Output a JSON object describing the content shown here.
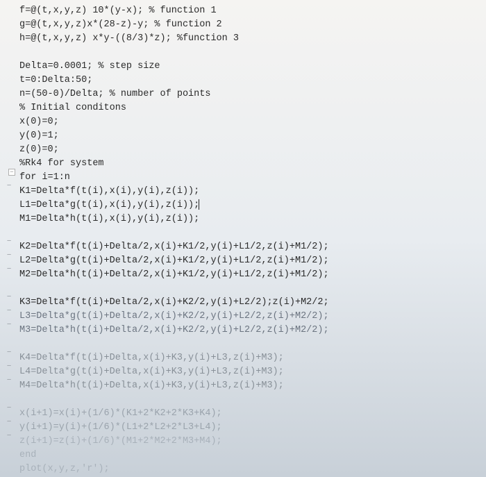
{
  "code": {
    "l1": "f=@(t,x,y,z) 10*(y-x); % function 1",
    "l2": "g=@(t,x,y,z)x*(28-z)-y; % function 2",
    "l3": "h=@(t,x,y,z) x*y-((8/3)*z); %function 3",
    "l4": "",
    "l5": "Delta=0.0001; % step size",
    "l6": "t=0:Delta:50;",
    "l7": "n=(50-0)/Delta; % number of points",
    "l8": "% Initial conditons",
    "l9": "x(0)=0;",
    "l10": "y(0)=1;",
    "l11": "z(0)=0;",
    "l12": "%Rk4 for system",
    "l13": "for i=1:n",
    "l14": "K1=Delta*f(t(i),x(i),y(i),z(i));",
    "l15": "L1=Delta*g(t(i),x(i),y(i),z(i));",
    "l16": "M1=Delta*h(t(i),x(i),y(i),z(i));",
    "l17": "",
    "l18": "K2=Delta*f(t(i)+Delta/2,x(i)+K1/2,y(i)+L1/2,z(i)+M1/2);",
    "l19": "L2=Delta*g(t(i)+Delta/2,x(i)+K1/2,y(i)+L1/2,z(i)+M1/2);",
    "l20": "M2=Delta*h(t(i)+Delta/2,x(i)+K1/2,y(i)+L1/2,z(i)+M1/2);",
    "l21": "",
    "l22": "K3=Delta*f(t(i)+Delta/2,x(i)+K2/2,y(i)+L2/2);z(i)+M2/2;",
    "l23": "L3=Delta*g(t(i)+Delta/2,x(i)+K2/2,y(i)+L2/2,z(i)+M2/2);",
    "l24": "M3=Delta*h(t(i)+Delta/2,x(i)+K2/2,y(i)+L2/2,z(i)+M2/2);",
    "l25": "",
    "l26": "K4=Delta*f(t(i)+Delta,x(i)+K3,y(i)+L3,z(i)+M3);",
    "l27": "L4=Delta*g(t(i)+Delta,x(i)+K3,y(i)+L3,z(i)+M3);",
    "l28": "M4=Delta*h(t(i)+Delta,x(i)+K3,y(i)+L3,z(i)+M3);",
    "l29": "",
    "l30": "x(i+1)=x(i)+(1/6)*(K1+2*K2+2*K3+K4);",
    "l31": "y(i+1)=y(i)+(1/6)*(L1+2*L2+2*L3+L4);",
    "l32": "z(i+1)=z(i)+(1/6)*(M1+2*M2+2*M3+M4);",
    "l33": "end",
    "l34": "plot(x,y,z,'r');"
  },
  "gutter": {
    "fold": "−",
    "dash": "−"
  }
}
